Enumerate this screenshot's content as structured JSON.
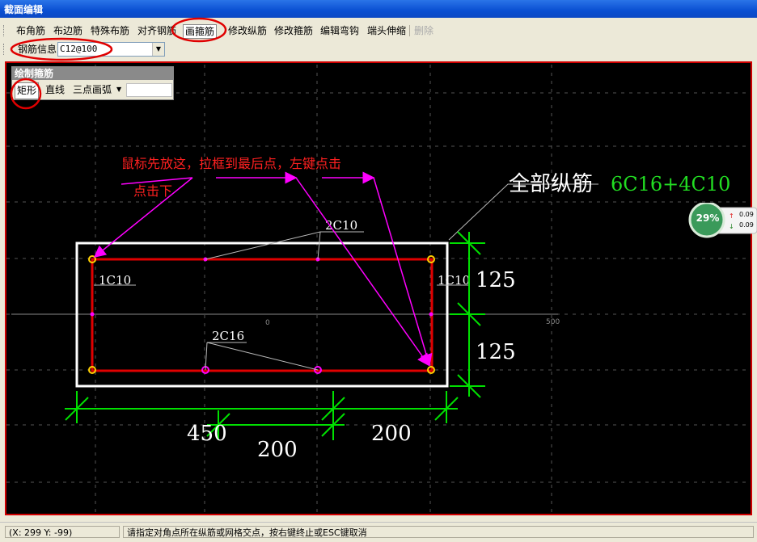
{
  "window": {
    "title": "截面编辑"
  },
  "toolbar": {
    "items": [
      {
        "label": "布角筋"
      },
      {
        "label": "布边筋"
      },
      {
        "label": "特殊布筋"
      },
      {
        "label": "对齐钢筋"
      },
      {
        "label": "画箍筋",
        "pressed": true
      },
      {
        "label": "修改纵筋"
      },
      {
        "label": "修改箍筋"
      },
      {
        "label": "编辑弯钩"
      },
      {
        "label": "端头伸缩"
      },
      {
        "label": "删除",
        "disabled": true
      }
    ]
  },
  "info": {
    "label": "钢筋信息",
    "value": "C12@100"
  },
  "palette": {
    "title": "绘制箍筋",
    "rect_label": "矩形",
    "line_label": "直线",
    "arc_label": "三点画弧"
  },
  "drawing": {
    "instruction_line1": "鼠标先放这，拉框到最后点，左键点击",
    "instruction_line2": "点击下",
    "all_rebar_label": "全部纵筋",
    "all_rebar_value": "6C16+4C10",
    "top_rebar": "2C10",
    "left_rebar": "1C10",
    "right_rebar": "1C10",
    "bottom_rebar": "2C16",
    "dim_right_top": "125",
    "dim_right_bottom": "125",
    "dim_bottom_left": "450",
    "dim_bottom_right": "200",
    "dim_bottom_inner": "200",
    "axis_origin": "0",
    "axis_500": "500"
  },
  "speed_widget": {
    "percent": "29%",
    "up": "0.09",
    "down": "0.09"
  },
  "statusbar": {
    "coords": "(X: 299 Y: -99)",
    "message": "请指定对角点所在纵筋或网格交点，按右键终止或ESC键取消"
  },
  "colors": {
    "accent_red": "#e00000",
    "dim_green": "#00e000",
    "rebar_label_green": "#22dd22",
    "magenta": "#ff00ff"
  }
}
